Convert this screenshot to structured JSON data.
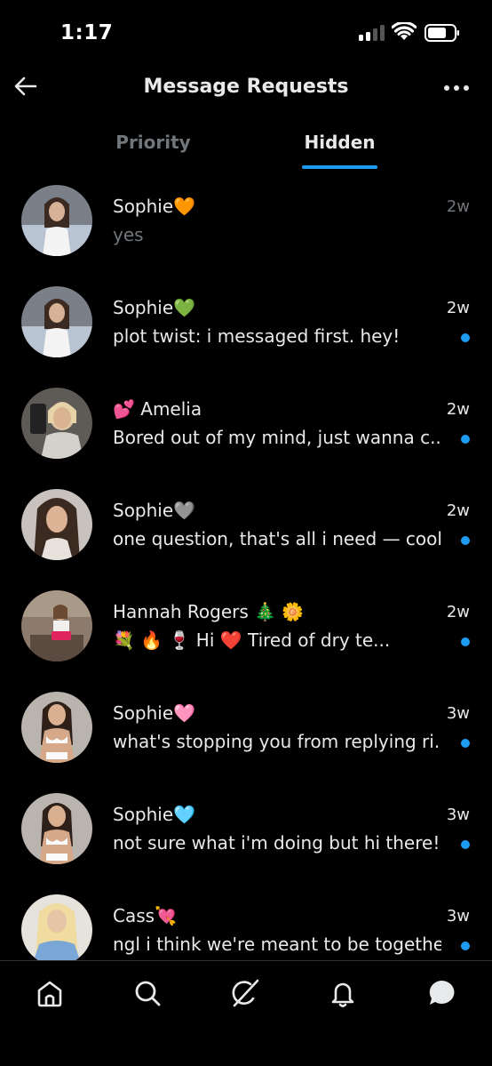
{
  "status_bar": {
    "time": "1:17"
  },
  "header": {
    "title": "Message Requests"
  },
  "tabs": [
    {
      "label": "Priority",
      "active": false
    },
    {
      "label": "Hidden",
      "active": true
    }
  ],
  "accent_color": "#1d9bf0",
  "conversations": [
    {
      "name": "Sophie🧡",
      "preview": "yes",
      "time": "2w",
      "unread": false
    },
    {
      "name": "Sophie💚",
      "preview": "plot twist: i messaged first. hey!",
      "time": "2w",
      "unread": true
    },
    {
      "name": "💕 Amelia",
      "preview": "Bored out of my mind, just wanna c...",
      "time": "2w",
      "unread": true
    },
    {
      "name": "Sophie🩶",
      "preview": "one question, that's all i need — cool?",
      "time": "2w",
      "unread": true
    },
    {
      "name": "Hannah Rogers 🎄 🌼",
      "preview": "💐 🔥 🍷 Hi ❤️ Tired of dry te...",
      "time": "2w",
      "unread": true
    },
    {
      "name": "Sophie🩷",
      "preview": "what's stopping you from replying ri...",
      "time": "3w",
      "unread": true
    },
    {
      "name": "Sophie🩵",
      "preview": "not sure what i'm doing but hi there!",
      "time": "3w",
      "unread": true
    },
    {
      "name": "Cass💘",
      "preview": "ngl i think we're meant to be together",
      "time": "3w",
      "unread": true
    }
  ],
  "bottom_nav": [
    {
      "icon": "home-icon"
    },
    {
      "icon": "search-icon"
    },
    {
      "icon": "grok-icon"
    },
    {
      "icon": "bell-icon"
    },
    {
      "icon": "messages-icon",
      "active": true
    }
  ]
}
